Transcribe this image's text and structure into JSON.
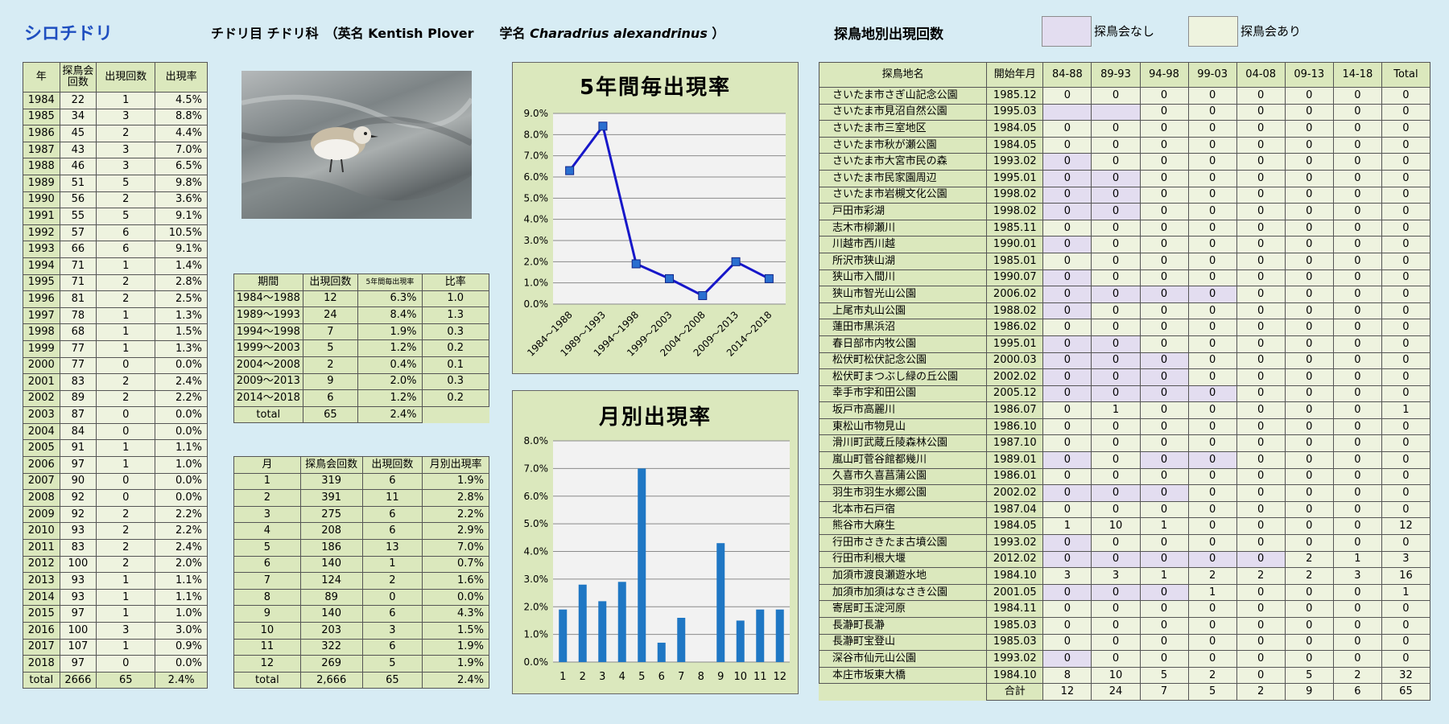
{
  "header": {
    "title": "シロチドリ",
    "order": "チドリ目 チドリ科",
    "english_label": "（英名 Kentish Plover",
    "latin_label": "学名",
    "latin_name": "Charadrius alexandrinus",
    "close_paren": "）",
    "areas_title": "探鳥地別出現回数",
    "legend_none": "探鳥会なし",
    "legend_yes": "探鳥会あり"
  },
  "colors": {
    "none_cell": "#e3ddf0",
    "yes_cell": "#eef3df",
    "header": "#dbe8bd",
    "line": "#1717c9",
    "bar": "#1f77c4"
  },
  "year_table": {
    "headers": [
      "年",
      "探鳥会回数",
      "出現回数",
      "出現率"
    ],
    "rows": [
      [
        "1984",
        "22",
        "1",
        "4.5%"
      ],
      [
        "1985",
        "34",
        "3",
        "8.8%"
      ],
      [
        "1986",
        "45",
        "2",
        "4.4%"
      ],
      [
        "1987",
        "43",
        "3",
        "7.0%"
      ],
      [
        "1988",
        "46",
        "3",
        "6.5%"
      ],
      [
        "1989",
        "51",
        "5",
        "9.8%"
      ],
      [
        "1990",
        "56",
        "2",
        "3.6%"
      ],
      [
        "1991",
        "55",
        "5",
        "9.1%"
      ],
      [
        "1992",
        "57",
        "6",
        "10.5%"
      ],
      [
        "1993",
        "66",
        "6",
        "9.1%"
      ],
      [
        "1994",
        "71",
        "1",
        "1.4%"
      ],
      [
        "1995",
        "71",
        "2",
        "2.8%"
      ],
      [
        "1996",
        "81",
        "2",
        "2.5%"
      ],
      [
        "1997",
        "78",
        "1",
        "1.3%"
      ],
      [
        "1998",
        "68",
        "1",
        "1.5%"
      ],
      [
        "1999",
        "77",
        "1",
        "1.3%"
      ],
      [
        "2000",
        "77",
        "0",
        "0.0%"
      ],
      [
        "2001",
        "83",
        "2",
        "2.4%"
      ],
      [
        "2002",
        "89",
        "2",
        "2.2%"
      ],
      [
        "2003",
        "87",
        "0",
        "0.0%"
      ],
      [
        "2004",
        "84",
        "0",
        "0.0%"
      ],
      [
        "2005",
        "91",
        "1",
        "1.1%"
      ],
      [
        "2006",
        "97",
        "1",
        "1.0%"
      ],
      [
        "2007",
        "90",
        "0",
        "0.0%"
      ],
      [
        "2008",
        "92",
        "0",
        "0.0%"
      ],
      [
        "2009",
        "92",
        "2",
        "2.2%"
      ],
      [
        "2010",
        "93",
        "2",
        "2.2%"
      ],
      [
        "2011",
        "83",
        "2",
        "2.4%"
      ],
      [
        "2012",
        "100",
        "2",
        "2.0%"
      ],
      [
        "2013",
        "93",
        "1",
        "1.1%"
      ],
      [
        "2014",
        "93",
        "1",
        "1.1%"
      ],
      [
        "2015",
        "97",
        "1",
        "1.0%"
      ],
      [
        "2016",
        "100",
        "3",
        "3.0%"
      ],
      [
        "2017",
        "107",
        "1",
        "0.9%"
      ],
      [
        "2018",
        "97",
        "0",
        "0.0%"
      ]
    ],
    "total": [
      "total",
      "2666",
      "65",
      "2.4%"
    ]
  },
  "period_table": {
    "headers": [
      "期間",
      "出現回数",
      "5年間毎出現率",
      "比率"
    ],
    "rows": [
      [
        "1984～1988",
        "12",
        "6.3%",
        "1.0"
      ],
      [
        "1989～1993",
        "24",
        "8.4%",
        "1.3"
      ],
      [
        "1994～1998",
        "7",
        "1.9%",
        "0.3"
      ],
      [
        "1999～2003",
        "5",
        "1.2%",
        "0.2"
      ],
      [
        "2004～2008",
        "2",
        "0.4%",
        "0.1"
      ],
      [
        "2009～2013",
        "9",
        "2.0%",
        "0.3"
      ],
      [
        "2014～2018",
        "6",
        "1.2%",
        "0.2"
      ]
    ],
    "total": [
      "total",
      "65",
      "2.4%"
    ]
  },
  "month_table": {
    "headers": [
      "月",
      "探鳥会回数",
      "出現回数",
      "月別出現率"
    ],
    "rows": [
      [
        "1",
        "319",
        "6",
        "1.9%"
      ],
      [
        "2",
        "391",
        "11",
        "2.8%"
      ],
      [
        "3",
        "275",
        "6",
        "2.2%"
      ],
      [
        "4",
        "208",
        "6",
        "2.9%"
      ],
      [
        "5",
        "186",
        "13",
        "7.0%"
      ],
      [
        "6",
        "140",
        "1",
        "0.7%"
      ],
      [
        "7",
        "124",
        "2",
        "1.6%"
      ],
      [
        "8",
        "89",
        "0",
        "0.0%"
      ],
      [
        "9",
        "140",
        "6",
        "4.3%"
      ],
      [
        "10",
        "203",
        "3",
        "1.5%"
      ],
      [
        "11",
        "322",
        "6",
        "1.9%"
      ],
      [
        "12",
        "269",
        "5",
        "1.9%"
      ]
    ],
    "total": [
      "total",
      "2,666",
      "65",
      "2.4%"
    ]
  },
  "chart_data": [
    {
      "type": "line",
      "title": "5年間毎出現率",
      "categories": [
        "1984～1988",
        "1989～1993",
        "1994～1998",
        "1999～2003",
        "2004～2008",
        "2009～2013",
        "2014～2018"
      ],
      "values": [
        6.3,
        8.4,
        1.9,
        1.2,
        0.4,
        2.0,
        1.2
      ],
      "ylim": [
        0,
        9
      ],
      "yticks": [
        "0.0%",
        "1.0%",
        "2.0%",
        "3.0%",
        "4.0%",
        "5.0%",
        "6.0%",
        "7.0%",
        "8.0%",
        "9.0%"
      ],
      "grid": true
    },
    {
      "type": "bar",
      "title": "月別出現率",
      "categories": [
        "1",
        "2",
        "3",
        "4",
        "5",
        "6",
        "7",
        "8",
        "9",
        "10",
        "11",
        "12"
      ],
      "values": [
        1.9,
        2.8,
        2.2,
        2.9,
        7.0,
        0.7,
        1.6,
        0.0,
        4.3,
        1.5,
        1.9,
        1.9
      ],
      "ylim": [
        0,
        8
      ],
      "yticks": [
        "0.0%",
        "1.0%",
        "2.0%",
        "3.0%",
        "4.0%",
        "5.0%",
        "6.0%",
        "7.0%",
        "8.0%"
      ],
      "grid": true
    }
  ],
  "site_table": {
    "headers": [
      "探鳥地名",
      "開始年月",
      "84-88",
      "89-93",
      "94-98",
      "99-03",
      "04-08",
      "09-13",
      "14-18",
      "Total"
    ],
    "rows": [
      {
        "cells": [
          "さいたま市さぎ山記念公園",
          "1985.12",
          "0",
          "0",
          "0",
          "0",
          "0",
          "0",
          "0",
          "0"
        ],
        "none": []
      },
      {
        "cells": [
          "さいたま市見沼自然公園",
          "1995.03",
          "",
          "",
          "0",
          "0",
          "0",
          "0",
          "0",
          "0"
        ],
        "none": [
          2,
          3
        ]
      },
      {
        "cells": [
          "さいたま市三室地区",
          "1984.05",
          "0",
          "0",
          "0",
          "0",
          "0",
          "0",
          "0",
          "0"
        ],
        "none": []
      },
      {
        "cells": [
          "さいたま市秋が瀬公園",
          "1984.05",
          "0",
          "0",
          "0",
          "0",
          "0",
          "0",
          "0",
          "0"
        ],
        "none": []
      },
      {
        "cells": [
          "さいたま市大宮市民の森",
          "1993.02",
          "0",
          "0",
          "0",
          "0",
          "0",
          "0",
          "0",
          "0"
        ],
        "none": [
          2
        ]
      },
      {
        "cells": [
          "さいたま市民家園周辺",
          "1995.01",
          "0",
          "0",
          "0",
          "0",
          "0",
          "0",
          "0",
          "0"
        ],
        "none": [
          2,
          3
        ]
      },
      {
        "cells": [
          "さいたま市岩槻文化公園",
          "1998.02",
          "0",
          "0",
          "0",
          "0",
          "0",
          "0",
          "0",
          "0"
        ],
        "none": [
          2,
          3
        ]
      },
      {
        "cells": [
          "戸田市彩湖",
          "1998.02",
          "0",
          "0",
          "0",
          "0",
          "0",
          "0",
          "0",
          "0"
        ],
        "none": [
          2,
          3
        ]
      },
      {
        "cells": [
          "志木市柳瀬川",
          "1985.11",
          "0",
          "0",
          "0",
          "0",
          "0",
          "0",
          "0",
          "0"
        ],
        "none": []
      },
      {
        "cells": [
          "川越市西川越",
          "1990.01",
          "0",
          "0",
          "0",
          "0",
          "0",
          "0",
          "0",
          "0"
        ],
        "none": [
          2
        ]
      },
      {
        "cells": [
          "所沢市狭山湖",
          "1985.01",
          "0",
          "0",
          "0",
          "0",
          "0",
          "0",
          "0",
          "0"
        ],
        "none": []
      },
      {
        "cells": [
          "狭山市入間川",
          "1990.07",
          "0",
          "0",
          "0",
          "0",
          "0",
          "0",
          "0",
          "0"
        ],
        "none": [
          2
        ]
      },
      {
        "cells": [
          "狭山市智光山公園",
          "2006.02",
          "0",
          "0",
          "0",
          "0",
          "0",
          "0",
          "0",
          "0"
        ],
        "none": [
          2,
          3,
          4,
          5
        ]
      },
      {
        "cells": [
          "上尾市丸山公園",
          "1988.02",
          "0",
          "0",
          "0",
          "0",
          "0",
          "0",
          "0",
          "0"
        ],
        "none": [
          2
        ]
      },
      {
        "cells": [
          "蓮田市黒浜沼",
          "1986.02",
          "0",
          "0",
          "0",
          "0",
          "0",
          "0",
          "0",
          "0"
        ],
        "none": []
      },
      {
        "cells": [
          "春日部市内牧公園",
          "1995.01",
          "0",
          "0",
          "0",
          "0",
          "0",
          "0",
          "0",
          "0"
        ],
        "none": [
          2,
          3
        ]
      },
      {
        "cells": [
          "松伏町松伏記念公園",
          "2000.03",
          "0",
          "0",
          "0",
          "0",
          "0",
          "0",
          "0",
          "0"
        ],
        "none": [
          2,
          3,
          4
        ]
      },
      {
        "cells": [
          "松伏町まつぶし緑の丘公園",
          "2002.02",
          "0",
          "0",
          "0",
          "0",
          "0",
          "0",
          "0",
          "0"
        ],
        "none": [
          2,
          3,
          4
        ]
      },
      {
        "cells": [
          "幸手市宇和田公園",
          "2005.12",
          "0",
          "0",
          "0",
          "0",
          "0",
          "0",
          "0",
          "0"
        ],
        "none": [
          2,
          3,
          4,
          5
        ]
      },
      {
        "cells": [
          "坂戸市高麗川",
          "1986.07",
          "0",
          "1",
          "0",
          "0",
          "0",
          "0",
          "0",
          "1"
        ],
        "none": []
      },
      {
        "cells": [
          "東松山市物見山",
          "1986.10",
          "0",
          "0",
          "0",
          "0",
          "0",
          "0",
          "0",
          "0"
        ],
        "none": []
      },
      {
        "cells": [
          "滑川町武蔵丘陵森林公園",
          "1987.10",
          "0",
          "0",
          "0",
          "0",
          "0",
          "0",
          "0",
          "0"
        ],
        "none": []
      },
      {
        "cells": [
          "嵐山町菅谷館都幾川",
          "1989.01",
          "0",
          "0",
          "0",
          "0",
          "0",
          "0",
          "0",
          "0"
        ],
        "none": [
          2,
          4,
          5
        ]
      },
      {
        "cells": [
          "久喜市久喜菖蒲公園",
          "1986.01",
          "0",
          "0",
          "0",
          "0",
          "0",
          "0",
          "0",
          "0"
        ],
        "none": []
      },
      {
        "cells": [
          "羽生市羽生水郷公園",
          "2002.02",
          "0",
          "0",
          "0",
          "0",
          "0",
          "0",
          "0",
          "0"
        ],
        "none": [
          2,
          3,
          4
        ]
      },
      {
        "cells": [
          "北本市石戸宿",
          "1987.04",
          "0",
          "0",
          "0",
          "0",
          "0",
          "0",
          "0",
          "0"
        ],
        "none": []
      },
      {
        "cells": [
          "熊谷市大麻生",
          "1984.05",
          "1",
          "10",
          "1",
          "0",
          "0",
          "0",
          "0",
          "12"
        ],
        "none": []
      },
      {
        "cells": [
          "行田市さきたま古墳公園",
          "1993.02",
          "0",
          "0",
          "0",
          "0",
          "0",
          "0",
          "0",
          "0"
        ],
        "none": [
          2
        ]
      },
      {
        "cells": [
          "行田市利根大堰",
          "2012.02",
          "0",
          "0",
          "0",
          "0",
          "0",
          "2",
          "1",
          "3"
        ],
        "none": [
          2,
          3,
          4,
          5,
          6
        ]
      },
      {
        "cells": [
          "加須市渡良瀬遊水地",
          "1984.10",
          "3",
          "3",
          "1",
          "2",
          "2",
          "2",
          "3",
          "16"
        ],
        "none": []
      },
      {
        "cells": [
          "加須市加須はなさき公園",
          "2001.05",
          "0",
          "0",
          "0",
          "1",
          "0",
          "0",
          "0",
          "1"
        ],
        "none": [
          2,
          3,
          4
        ]
      },
      {
        "cells": [
          "寄居町玉淀河原",
          "1984.11",
          "0",
          "0",
          "0",
          "0",
          "0",
          "0",
          "0",
          "0"
        ],
        "none": []
      },
      {
        "cells": [
          "長瀞町長瀞",
          "1985.03",
          "0",
          "0",
          "0",
          "0",
          "0",
          "0",
          "0",
          "0"
        ],
        "none": []
      },
      {
        "cells": [
          "長瀞町宝登山",
          "1985.03",
          "0",
          "0",
          "0",
          "0",
          "0",
          "0",
          "0",
          "0"
        ],
        "none": []
      },
      {
        "cells": [
          "深谷市仙元山公園",
          "1993.02",
          "0",
          "0",
          "0",
          "0",
          "0",
          "0",
          "0",
          "0"
        ],
        "none": [
          2
        ]
      },
      {
        "cells": [
          "本庄市坂東大橋",
          "1984.10",
          "8",
          "10",
          "5",
          "2",
          "0",
          "5",
          "2",
          "32"
        ],
        "none": []
      }
    ],
    "total": [
      "合計",
      "12",
      "24",
      "7",
      "5",
      "2",
      "9",
      "6",
      "65"
    ]
  }
}
